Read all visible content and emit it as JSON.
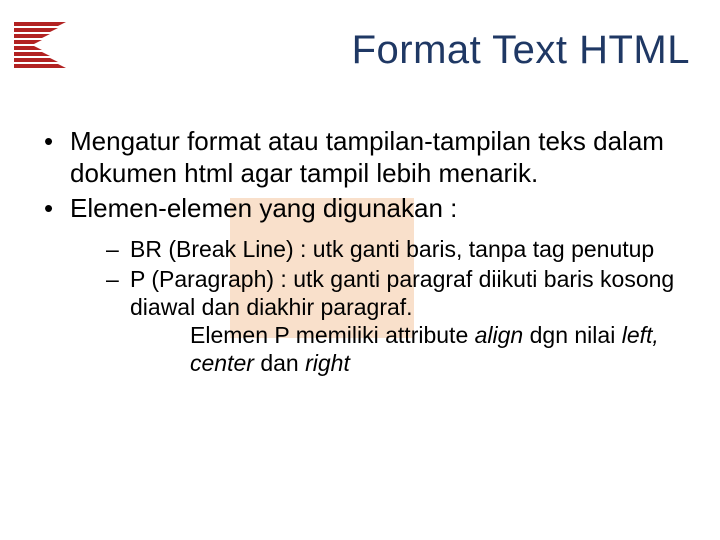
{
  "title": "Format Text HTML",
  "bullets": [
    "Mengatur format atau tampilan-tampilan teks dalam dokumen html agar tampil lebih menarik.",
    "Elemen-elemen yang digunakan :"
  ],
  "subbullets": [
    "BR (Break Line) : utk ganti baris, tanpa tag penutup",
    "P (Paragraph) : utk ganti paragraf diikuti baris kosong diawal dan diakhir paragraf."
  ],
  "sub_extra_prefix": "Elemen P memiliki attribute ",
  "attr_align": "align",
  "sub_extra_mid1": " dgn nilai ",
  "attr_left": "left,",
  "attr_center": " center",
  "sub_extra_mid2": " dan ",
  "attr_right": "right"
}
